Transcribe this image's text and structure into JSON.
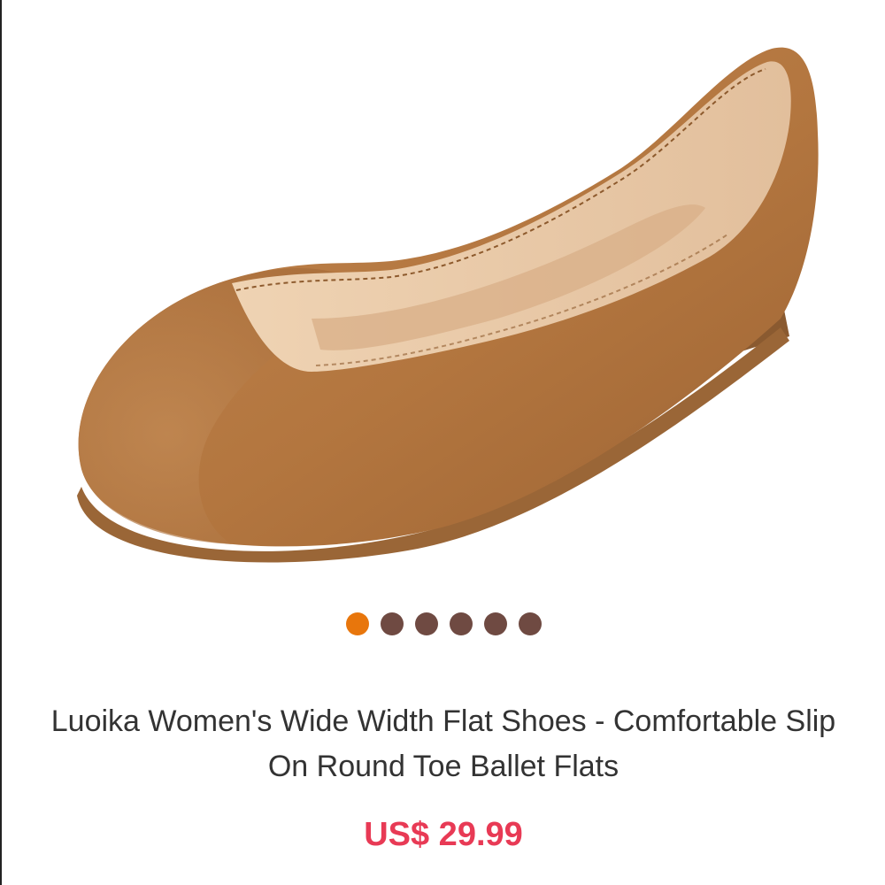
{
  "product": {
    "image_alt": "Brown suede ballet flat shoe",
    "title": "Luoika Women's Wide Width Flat Shoes - Comfortable Slip On Round Toe Ballet Flats",
    "price": "US$ 29.99"
  },
  "carousel": {
    "active_index": 0,
    "dots": [
      {
        "index": 1
      },
      {
        "index": 2
      },
      {
        "index": 3
      },
      {
        "index": 4
      },
      {
        "index": 5
      },
      {
        "index": 6
      }
    ]
  },
  "colors": {
    "active_dot": "#e8760c",
    "inactive_dot": "#6f4a42",
    "price": "#e83a55",
    "title": "#333333",
    "shoe_suede": "#b87a44",
    "shoe_lining": "#e8c9a8"
  }
}
